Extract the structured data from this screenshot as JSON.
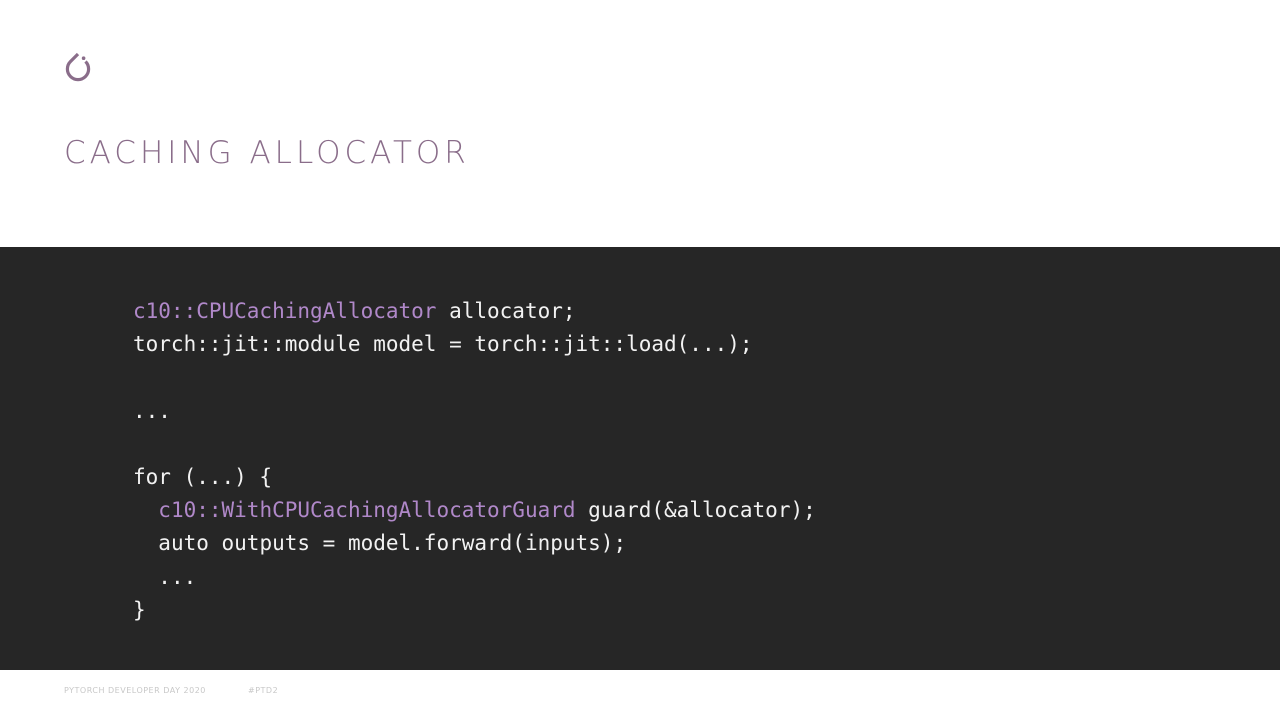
{
  "slide": {
    "title": "CACHING ALLOCATOR",
    "logo_icon": "pytorch-logo-icon",
    "accent_color": "#8a6d8a",
    "code_bg_color": "#262626"
  },
  "code": {
    "lines": [
      {
        "indent": "",
        "type_name": "c10::CPUCachingAllocator",
        "text": " allocator;"
      },
      {
        "indent": "",
        "type_name": "",
        "text": "torch::jit::module model = torch::jit::load(...);"
      },
      {
        "indent": "",
        "type_name": "",
        "text": ""
      },
      {
        "indent": "",
        "type_name": "",
        "text": "..."
      },
      {
        "indent": "",
        "type_name": "",
        "text": ""
      },
      {
        "indent": "",
        "type_name": "",
        "text": "for (...) {"
      },
      {
        "indent": "  ",
        "type_name": "c10::WithCPUCachingAllocatorGuard",
        "text": " guard(&allocator);"
      },
      {
        "indent": "  ",
        "type_name": "",
        "text": "auto outputs = model.forward(inputs);"
      },
      {
        "indent": "  ",
        "type_name": "",
        "text": "..."
      },
      {
        "indent": "",
        "type_name": "",
        "text": "}"
      }
    ]
  },
  "footer": {
    "event": "PYTORCH DEVELOPER DAY 2020",
    "hashtag": "#PTD2"
  }
}
